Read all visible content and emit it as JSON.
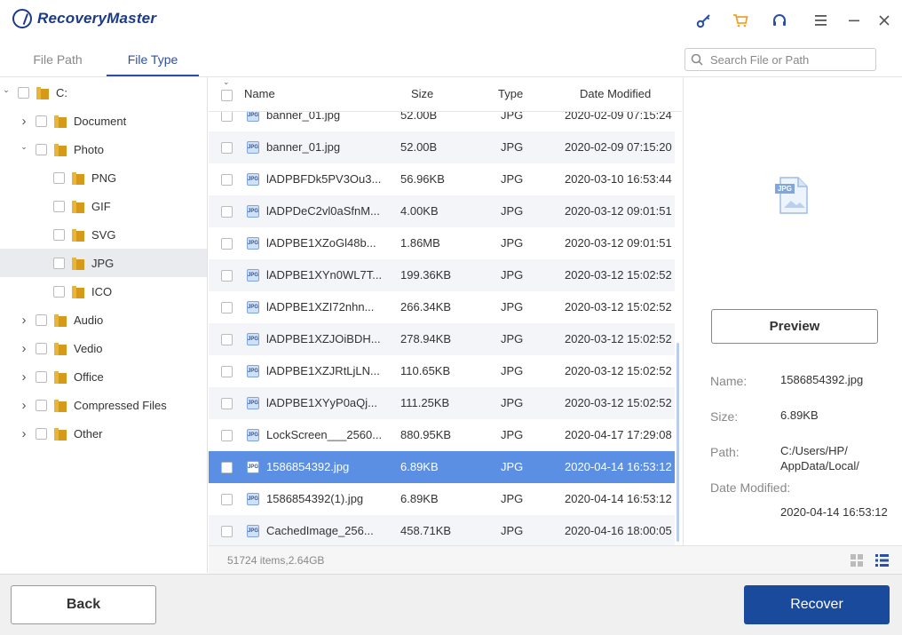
{
  "app": {
    "title": "RecoveryMaster"
  },
  "colors": {
    "brand": "#1a3b8c",
    "accent": "#2b4fa6",
    "selection": "#5b8fe4",
    "recover_button": "#1a4a9c",
    "cart_icon": "#f0a030"
  },
  "titlebar_icons": [
    "key-icon",
    "cart-icon",
    "headset-icon",
    "menu-icon",
    "minimize-icon",
    "close-icon"
  ],
  "tabs": [
    {
      "label": "File Path"
    },
    {
      "label": "File Type",
      "active": true
    }
  ],
  "search": {
    "placeholder": "Search File or Path",
    "value": ""
  },
  "tree": [
    {
      "label": "C:",
      "level": 0,
      "expanded": true
    },
    {
      "label": "Document",
      "level": 1,
      "expanded": false
    },
    {
      "label": "Photo",
      "level": 1,
      "expanded": true
    },
    {
      "label": "PNG",
      "level": 2
    },
    {
      "label": "GIF",
      "level": 2
    },
    {
      "label": "SVG",
      "level": 2
    },
    {
      "label": "JPG",
      "level": 2,
      "selected": true
    },
    {
      "label": "ICO",
      "level": 2
    },
    {
      "label": "Audio",
      "level": 1,
      "expanded": false
    },
    {
      "label": "Vedio",
      "level": 1,
      "expanded": false
    },
    {
      "label": "Office",
      "level": 1,
      "expanded": false
    },
    {
      "label": "Compressed Files",
      "level": 1,
      "expanded": false
    },
    {
      "label": "Other",
      "level": 1,
      "expanded": false
    }
  ],
  "columns": {
    "name": "Name",
    "size": "Size",
    "type": "Type",
    "date": "Date Modified"
  },
  "file_icon_label": "JPG",
  "files": [
    {
      "name": "banner_01.jpg",
      "size": "52.00B",
      "type": "JPG",
      "date": "2020-02-09 07:15:24"
    },
    {
      "name": "banner_01.jpg",
      "size": "52.00B",
      "type": "JPG",
      "date": "2020-02-09 07:15:20"
    },
    {
      "name": "lADPBFDk5PV3Ou3...",
      "size": "56.96KB",
      "type": "JPG",
      "date": "2020-03-10 16:53:44"
    },
    {
      "name": "lADPDeC2vl0aSfnM...",
      "size": "4.00KB",
      "type": "JPG",
      "date": "2020-03-12 09:01:51"
    },
    {
      "name": "lADPBE1XZoGl48b...",
      "size": "1.86MB",
      "type": "JPG",
      "date": "2020-03-12 09:01:51"
    },
    {
      "name": "lADPBE1XYn0WL7T...",
      "size": "199.36KB",
      "type": "JPG",
      "date": "2020-03-12 15:02:52"
    },
    {
      "name": "lADPBE1XZI72nhn...",
      "size": "266.34KB",
      "type": "JPG",
      "date": "2020-03-12 15:02:52"
    },
    {
      "name": "lADPBE1XZJOiBDH...",
      "size": "278.94KB",
      "type": "JPG",
      "date": "2020-03-12 15:02:52"
    },
    {
      "name": "lADPBE1XZJRtLjLN...",
      "size": "110.65KB",
      "type": "JPG",
      "date": "2020-03-12 15:02:52"
    },
    {
      "name": "lADPBE1XYyP0aQj...",
      "size": "111.25KB",
      "type": "JPG",
      "date": "2020-03-12 15:02:52"
    },
    {
      "name": "LockScreen___2560...",
      "size": "880.95KB",
      "type": "JPG",
      "date": "2020-04-17 17:29:08"
    },
    {
      "name": "1586854392.jpg",
      "size": "6.89KB",
      "type": "JPG",
      "date": "2020-04-14 16:53:12",
      "selected": true
    },
    {
      "name": "1586854392(1).jpg",
      "size": "6.89KB",
      "type": "JPG",
      "date": "2020-04-14 16:53:12"
    },
    {
      "name": "CachedImage_256...",
      "size": "458.71KB",
      "type": "JPG",
      "date": "2020-04-16 18:00:05"
    }
  ],
  "status": {
    "summary": "51724 items,2.64GB"
  },
  "view_icons": [
    "grid-view-icon",
    "list-view-icon"
  ],
  "preview": {
    "icon_label": "JPG",
    "button_label": "Preview",
    "name_label": "Name:",
    "name_value": "1586854392.jpg",
    "size_label": "Size:",
    "size_value": "6.89KB",
    "path_label": "Path:",
    "path_line1": "C:/Users/HP/",
    "path_line2": "AppData/Local/",
    "date_label": "Date Modified:",
    "date_value": "2020-04-14 16:53:12"
  },
  "footer": {
    "back_label": "Back",
    "recover_label": "Recover"
  }
}
